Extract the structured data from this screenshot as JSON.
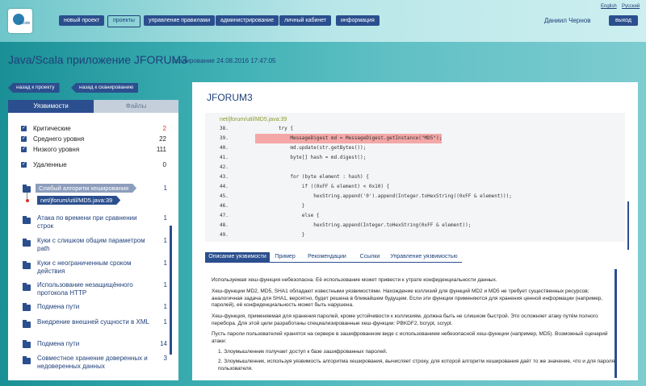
{
  "logo": {
    "text": "ICode"
  },
  "nav": [
    {
      "label": "новый проект"
    },
    {
      "label": "проекты",
      "active": true
    },
    {
      "label": "управление правилами"
    },
    {
      "label": "администрирование"
    },
    {
      "label": "личный кабинет"
    },
    {
      "label": "информация"
    }
  ],
  "user": {
    "name": "Даниил Чернов"
  },
  "lang": {
    "en": "English",
    "ru": "Русский"
  },
  "exit_label": "выход",
  "page": {
    "title": "Java/Scala приложение JFORUM3",
    "scan": "сканирование 24.08.2016 17:47:05"
  },
  "back": {
    "project": "назад к проекту",
    "scan": "назад к сканированию"
  },
  "left": {
    "tabs": [
      "Уязвимости",
      "Файлы"
    ],
    "severities": [
      {
        "label": "Критические",
        "count": "2",
        "color": "#d9342b"
      },
      {
        "label": "Среднего уровня",
        "count": "22"
      },
      {
        "label": "Низкого уровня",
        "count": "111"
      },
      {
        "label": "Удаленные",
        "count": "0"
      }
    ],
    "selected_vuln": "Слабый алгоритм хеширования",
    "selected_vuln_count": "1",
    "selected_file": "net/jforum/util/MD5.java:39",
    "vulns": [
      {
        "title": "Атака по времени при сравнении строк",
        "count": "1"
      },
      {
        "title": "Куки с слишком общим параметром path",
        "count": "1"
      },
      {
        "title": "Куки с неограниченным сроком действия",
        "count": "1"
      },
      {
        "title": "Использование незащищённого протокола HTTP",
        "count": "1"
      },
      {
        "title": "Подмена пути",
        "count": "1"
      },
      {
        "title": "Внедрение внешней сущности в XML",
        "count": "1"
      },
      {
        "title": "Подмена пути",
        "count": "14"
      },
      {
        "title": "Совместное хранение доверенных и недоверенных данных",
        "count": "3"
      }
    ]
  },
  "right": {
    "title": "JFORUM3",
    "file_path": "net/jforum/util/MD5.java:39",
    "code": [
      {
        "n": "38.",
        "t": "        try {"
      },
      {
        "n": "39.",
        "t": "            MessageDigest md = MessageDigest.getInstance(\"MD5\");",
        "hl": true
      },
      {
        "n": "40.",
        "t": "            md.update(str.getBytes());"
      },
      {
        "n": "41.",
        "t": "            byte[] hash = md.digest();"
      },
      {
        "n": "42.",
        "t": ""
      },
      {
        "n": "43.",
        "t": "            for (byte element : hash) {"
      },
      {
        "n": "44.",
        "t": "                if ((0xFF & element) < 0x10) {"
      },
      {
        "n": "45.",
        "t": "                    hexString.append('0').append(Integer.toHexString((0xFF & element)));"
      },
      {
        "n": "46.",
        "t": "                }"
      },
      {
        "n": "47.",
        "t": "                else {"
      },
      {
        "n": "48.",
        "t": "                    hexString.append(Integer.toHexString(0xFF & element));"
      },
      {
        "n": "49.",
        "t": "                }"
      },
      {
        "n": "50.",
        "t": "            }"
      }
    ],
    "detail_tabs": [
      "Описание уязвимости",
      "Пример",
      "Рекомендации",
      "Ссылки",
      "Управление уязвимостью"
    ],
    "description": [
      "Используемая хеш-функция небезопасна. Её использование может привести к утрате конфиденциальности данных.",
      "Хеш-функции MD2, MD5, SHA1 обладают известными уязвимостями. Нахождение коллизий для функций MD2 и MD5 не требует существенных ресурсов; аналогичная задача для SHA1, вероятно, будет решена в ближайшем будущем. Если эти функции применяются для хранения ценной информации (например, паролей), её конфиденциальность может быть нарушена.",
      "Хеш-функция, применяемая для хранения паролей, кроме устойчивости к коллизиям, должна быть не слишком быстрой. Это осложняет атаку путём полного перебора. Для этой цели разработаны специализированные хеш-функции: PBKDF2, bcrypt, scrypt.",
      "Пусть пароли пользователей хранятся на сервере в зашифрованном виде с использованием небезопасной хеш-функции (например, MD5). Возможный сценарий атаки:",
      "1.  Злоумышленник получает доступ к базе зашифрованных паролей.",
      "2.  Злоумышленник, используя уязвимость алгоритма хеширования, вычисляет строку, для которой алгоритм хеширования даёт то же значение, что и для пароля пользователя."
    ]
  }
}
